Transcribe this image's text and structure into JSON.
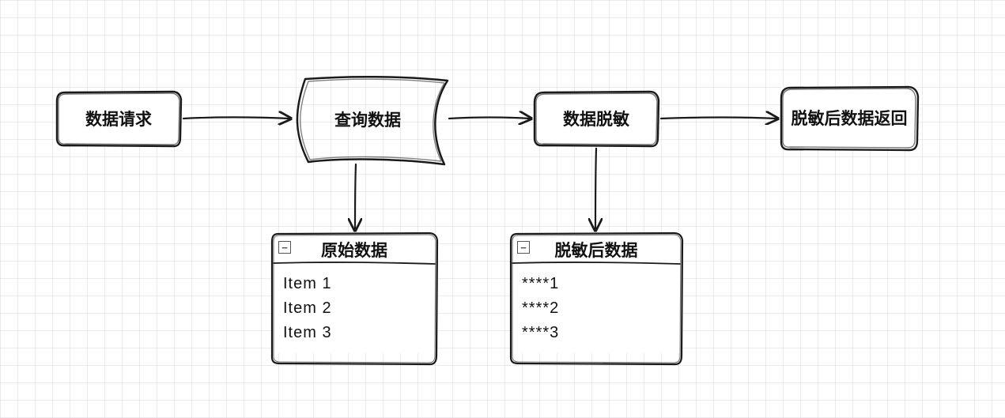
{
  "nodes": {
    "request": {
      "label": "数据请求"
    },
    "query": {
      "label": "查询数据"
    },
    "mask": {
      "label": "数据脱敏"
    },
    "return": {
      "label": "脱敏后数据返回"
    }
  },
  "lists": {
    "raw": {
      "title": "原始数据",
      "items": [
        "Item 1",
        "Item 2",
        "Item 3"
      ]
    },
    "masked": {
      "title": "脱敏后数据",
      "items": [
        "****1",
        "****2",
        "****3"
      ]
    }
  },
  "icons": {
    "minus": "−"
  }
}
